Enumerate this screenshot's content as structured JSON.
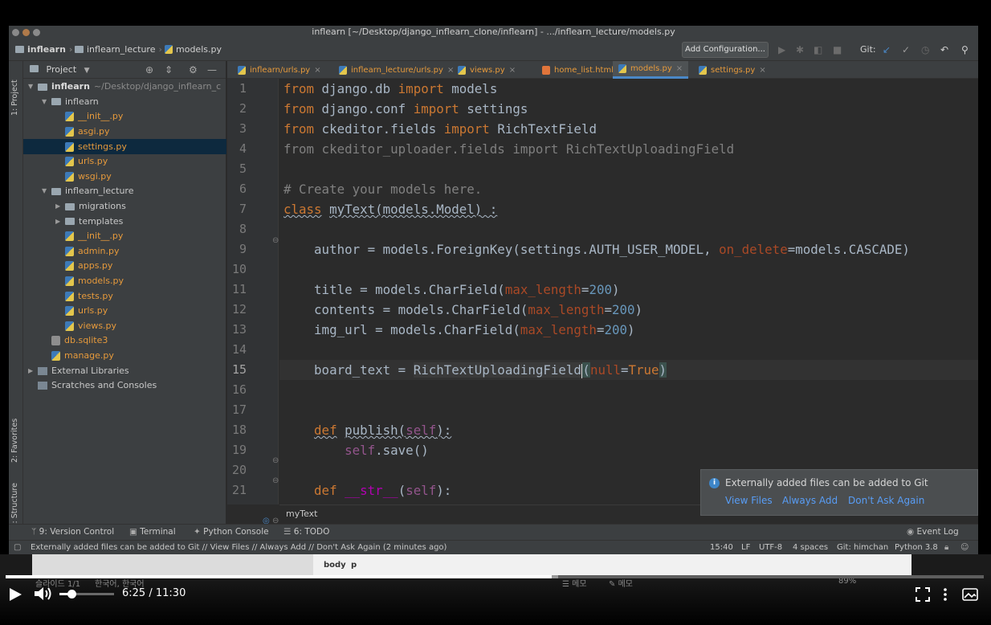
{
  "titlebar": {
    "title": "inflearn [~/Desktop/django_inflearn_clone/inflearn] - .../inflearn_lecture/models.py"
  },
  "navbar": {
    "crumbs": [
      "inflearn",
      "inflearn_lecture",
      "models.py"
    ],
    "add_config": "Add Configuration...",
    "git_label": "Git:"
  },
  "left_strip": {
    "project_tab": "1: Project",
    "favorites_tab": "2: Favorites",
    "structure_tab": "Z: Structure"
  },
  "project": {
    "header": "Project",
    "tree": [
      {
        "label": "inflearn",
        "path": "~/Desktop/django_inflearn_c",
        "type": "folder",
        "depth": 0,
        "open": true,
        "bold": true
      },
      {
        "label": "inflearn",
        "type": "folder",
        "depth": 1,
        "open": true,
        "bold": false
      },
      {
        "label": "__init__.py",
        "type": "py",
        "depth": 2
      },
      {
        "label": "asgi.py",
        "type": "py",
        "depth": 2
      },
      {
        "label": "settings.py",
        "type": "py",
        "depth": 2,
        "selected": true
      },
      {
        "label": "urls.py",
        "type": "py",
        "depth": 2
      },
      {
        "label": "wsgi.py",
        "type": "py",
        "depth": 2
      },
      {
        "label": "inflearn_lecture",
        "type": "folder",
        "depth": 1,
        "open": true
      },
      {
        "label": "migrations",
        "type": "folder",
        "depth": 2,
        "open": false
      },
      {
        "label": "templates",
        "type": "folder",
        "depth": 2,
        "open": false
      },
      {
        "label": "__init__.py",
        "type": "py",
        "depth": 2
      },
      {
        "label": "admin.py",
        "type": "py",
        "depth": 2
      },
      {
        "label": "apps.py",
        "type": "py",
        "depth": 2
      },
      {
        "label": "models.py",
        "type": "py",
        "depth": 2
      },
      {
        "label": "tests.py",
        "type": "py",
        "depth": 2
      },
      {
        "label": "urls.py",
        "type": "py",
        "depth": 2
      },
      {
        "label": "views.py",
        "type": "py",
        "depth": 2
      },
      {
        "label": "db.sqlite3",
        "type": "db",
        "depth": 1
      },
      {
        "label": "manage.py",
        "type": "py",
        "depth": 1
      },
      {
        "label": "External Libraries",
        "type": "lib",
        "depth": 0,
        "open": false,
        "plain": true
      },
      {
        "label": "Scratches and Consoles",
        "type": "lib",
        "depth": 0,
        "plain": true
      }
    ]
  },
  "tabs": [
    {
      "label": "inflearn/urls.py",
      "active": false
    },
    {
      "label": "inflearn_lecture/urls.py",
      "active": false
    },
    {
      "label": "views.py",
      "active": false
    },
    {
      "label": "home_list.html",
      "active": false
    },
    {
      "label": "models.py",
      "active": true
    },
    {
      "label": "settings.py",
      "active": false
    }
  ],
  "editor": {
    "line_numbers": [
      "1",
      "2",
      "3",
      "4",
      "5",
      "6",
      "7",
      "8",
      "9",
      "10",
      "11",
      "12",
      "13",
      "14",
      "15",
      "16",
      "17",
      "18",
      "19",
      "20",
      "21"
    ],
    "current_line": 15,
    "breadcrumb": "myText"
  },
  "toolwindows": {
    "version_control": "9: Version Control",
    "terminal": "Terminal",
    "python_console": "Python Console",
    "todo": "6: TODO",
    "event_log": "Event Log"
  },
  "statusbar": {
    "message": "Externally added files can be added to Git // View Files // Always Add // Don't Ask Again (2 minutes ago)",
    "position": "15:40",
    "line_sep": "LF",
    "encoding": "UTF-8",
    "indent": "4 spaces",
    "branch": "Git: himchan",
    "interpreter": "Python 3.8"
  },
  "notification": {
    "message": "Externally added files can be added to Git",
    "links": [
      "View Files",
      "Always Add",
      "Don't Ask Again"
    ]
  },
  "slide_strip": {
    "slide_label": "슬라이드 1/1",
    "lang_label": "한국어, 한국어",
    "notes_label": "메모",
    "comments_label": "메모",
    "body_label": "body",
    "p_label": "p",
    "zoom": "89%"
  },
  "player": {
    "current_time": "6:25",
    "duration": "11:30",
    "time_separator": "/",
    "progress": 0.558,
    "buffered": 0.565,
    "volume": 0.22
  },
  "colors": {
    "keyword": "#cc7832",
    "comment": "#808080",
    "number": "#6897bb",
    "param": "#aa4926",
    "link": "#589df6",
    "tab_file": "#e69a3c"
  }
}
